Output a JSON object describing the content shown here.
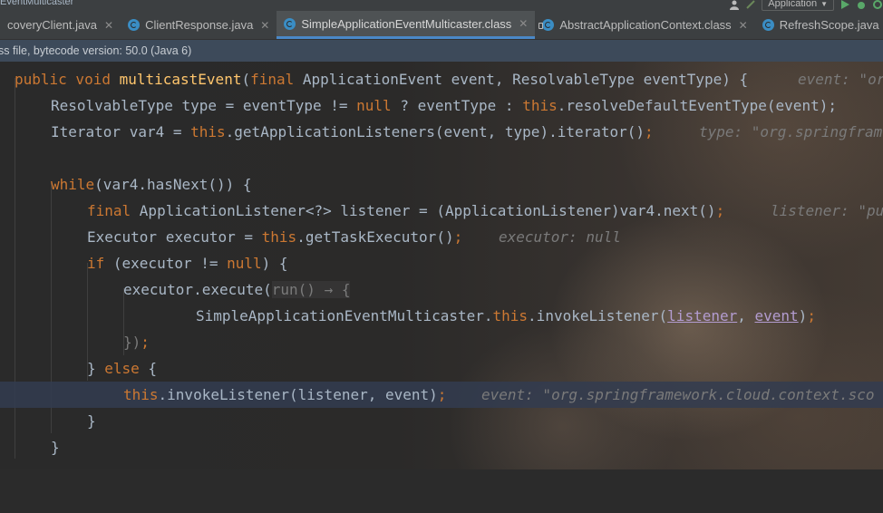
{
  "top_strip": {
    "crumb": "EventMulticaster",
    "run_config": "Application"
  },
  "tabs": [
    {
      "label": "coveryClient.java",
      "active": false
    },
    {
      "label": "ClientResponse.java",
      "active": false
    },
    {
      "label": "SimpleApplicationEventMulticaster.class",
      "active": true
    },
    {
      "label": "AbstractApplicationContext.class",
      "active": false
    },
    {
      "label": "RefreshScope.java",
      "active": false
    }
  ],
  "banner": {
    "text": "ss file, bytecode version: 50.0 (Java 6)"
  },
  "code": {
    "l1": {
      "kw1": "public void ",
      "fn": "multicastEvent",
      "p1": "(",
      "kw2": "final ",
      "rest": "ApplicationEvent event, ResolvableType eventType) {",
      "hint": "event: \"or"
    },
    "l2": {
      "a": "ResolvableType type = eventType != ",
      "kw1": "null",
      "b": " ? eventType : ",
      "kw2": "this",
      "c": ".resolveDefaultEventType(event);"
    },
    "l3": {
      "a": "Iterator var4 = ",
      "kw1": "this",
      "b": ".getApplicationListeners(event, type).iterator()",
      "semi": ";",
      "hint": "type: \"org.springfram"
    },
    "l5": {
      "kw1": "while",
      "a": "(var4.hasNext()) {"
    },
    "l6": {
      "kw1": "final ",
      "a": "ApplicationListener<?> listener = (ApplicationListener)var4.next()",
      "semi": ";",
      "hint": "listener: \"pu"
    },
    "l7": {
      "a": "Executor executor = ",
      "kw1": "this",
      "b": ".getTaskExecutor()",
      "semi": ";",
      "hint": "executor: null"
    },
    "l8": {
      "kw1": "if",
      "a": " (executor != ",
      "kw2": "null",
      "b": ") {"
    },
    "l9": {
      "a": "executor.execute(",
      "lam": "run() → {"
    },
    "l10": {
      "a": "SimpleApplicationEventMulticaster.",
      "kw1": "this",
      "b": ".invokeListener(",
      "p1": "listener",
      "comma": ", ",
      "p2": "event",
      "c": ")",
      "semi": ";"
    },
    "l11": {
      "a": "})",
      "semi": ";"
    },
    "l12": {
      "a": "} ",
      "kw1": "else",
      "b": " {"
    },
    "l13": {
      "kw1": "this",
      "a": ".invokeListener(listener, event)",
      "semi": ";",
      "hint": "event: \"org.springframework.cloud.context.sco"
    },
    "l14": {
      "a": "}"
    },
    "l15": {
      "a": "}"
    }
  },
  "colors": {
    "keyword": "#cc7832",
    "method": "#ffc66d",
    "text": "#a9b7c6",
    "hint": "#7a7a7a",
    "accent": "#4a88c7"
  }
}
